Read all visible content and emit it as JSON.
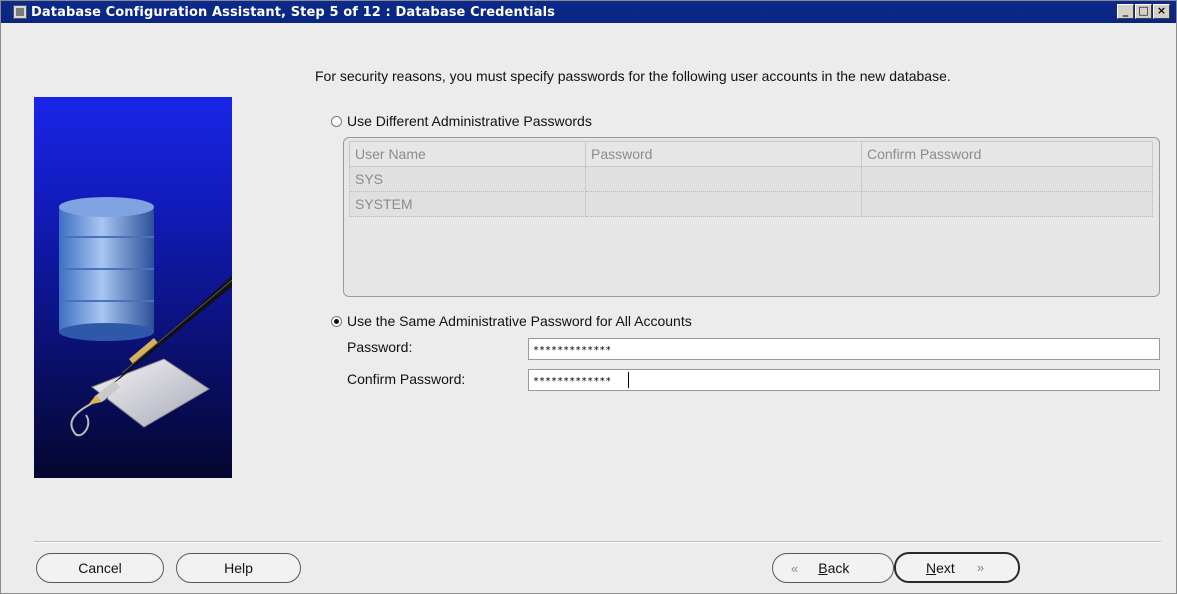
{
  "window": {
    "title": "Database Configuration Assistant, Step 5 of 12 : Database Credentials",
    "controls": [
      "_",
      "□",
      "×"
    ]
  },
  "intro_text": "For security reasons, you must specify passwords for the following user accounts in the new database.",
  "options": {
    "different": {
      "label": "Use Different Administrative Passwords",
      "selected": false
    },
    "same": {
      "label": "Use the Same Administrative Password for All Accounts",
      "selected": true
    }
  },
  "accounts_table": {
    "columns": [
      "User Name",
      "Password",
      "Confirm Password"
    ],
    "rows": [
      [
        "SYS",
        "",
        ""
      ],
      [
        "SYSTEM",
        "",
        ""
      ]
    ]
  },
  "password_form": {
    "password_label": "Password:",
    "password_value": "*************",
    "confirm_label": "Confirm Password:",
    "confirm_value": "*************"
  },
  "buttons": {
    "cancel": "Cancel",
    "help": "Help",
    "back_icon": "«",
    "back_mnemonic": "B",
    "back_rest": "ack",
    "next_mnemonic": "N",
    "next_rest": "ext",
    "next_icon": "»"
  },
  "icons": {
    "illustration": "database-cylinder-with-fountain-pen-and-tag",
    "app": "window-app-icon"
  }
}
